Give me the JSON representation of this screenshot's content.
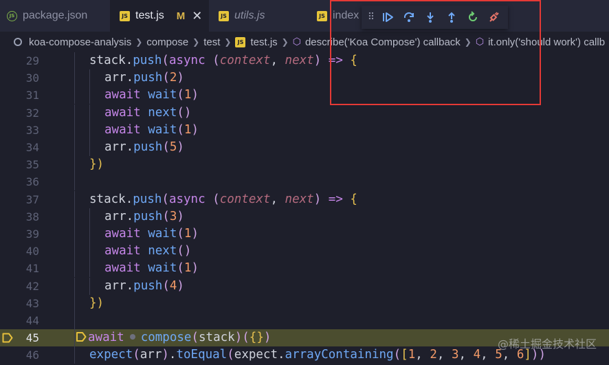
{
  "tabs": [
    {
      "label": "package.json",
      "icon": "json-file-icon"
    },
    {
      "label": "test.js",
      "icon": "js-file-icon",
      "modified": "M"
    },
    {
      "label": "utils.js",
      "icon": "js-file-icon"
    },
    {
      "label": "index",
      "icon": "js-file-icon"
    }
  ],
  "breadcrumb": [
    "koa-compose-analysis",
    "compose",
    "test",
    "test.js",
    "describe('Koa Compose') callback",
    "it.only('should work') callb"
  ],
  "debug_toolbar": {
    "buttons": [
      "continue",
      "step-over",
      "step-into",
      "step-out",
      "restart",
      "disconnect"
    ]
  },
  "code_lines": [
    {
      "num": "29",
      "indent": 1,
      "tokens": [
        [
          "stack",
          "plain"
        ],
        [
          ".",
          "punc"
        ],
        [
          "push",
          "fn"
        ],
        [
          "(",
          "paren"
        ],
        [
          "async ",
          "kw"
        ],
        [
          "(",
          "paren"
        ],
        [
          "context",
          "param"
        ],
        [
          ", ",
          "punc"
        ],
        [
          "next",
          "param"
        ],
        [
          ")",
          "paren"
        ],
        [
          " => ",
          "arrow"
        ],
        [
          "{",
          "brace"
        ]
      ]
    },
    {
      "num": "30",
      "indent": 2,
      "tokens": [
        [
          "arr",
          "plain"
        ],
        [
          ".",
          "punc"
        ],
        [
          "push",
          "fn"
        ],
        [
          "(",
          "paren"
        ],
        [
          "2",
          "num"
        ],
        [
          ")",
          "paren"
        ]
      ]
    },
    {
      "num": "31",
      "indent": 2,
      "tokens": [
        [
          "await ",
          "kw"
        ],
        [
          "wait",
          "fn"
        ],
        [
          "(",
          "paren"
        ],
        [
          "1",
          "num"
        ],
        [
          ")",
          "paren"
        ]
      ]
    },
    {
      "num": "32",
      "indent": 2,
      "tokens": [
        [
          "await ",
          "kw"
        ],
        [
          "next",
          "fn"
        ],
        [
          "()",
          "paren"
        ]
      ]
    },
    {
      "num": "33",
      "indent": 2,
      "tokens": [
        [
          "await ",
          "kw"
        ],
        [
          "wait",
          "fn"
        ],
        [
          "(",
          "paren"
        ],
        [
          "1",
          "num"
        ],
        [
          ")",
          "paren"
        ]
      ]
    },
    {
      "num": "34",
      "indent": 2,
      "tokens": [
        [
          "arr",
          "plain"
        ],
        [
          ".",
          "punc"
        ],
        [
          "push",
          "fn"
        ],
        [
          "(",
          "paren"
        ],
        [
          "5",
          "num"
        ],
        [
          ")",
          "paren"
        ]
      ]
    },
    {
      "num": "35",
      "indent": 1,
      "tokens": [
        [
          "})",
          "brace"
        ]
      ]
    },
    {
      "num": "36",
      "indent": 0,
      "tokens": []
    },
    {
      "num": "37",
      "indent": 1,
      "tokens": [
        [
          "stack",
          "plain"
        ],
        [
          ".",
          "punc"
        ],
        [
          "push",
          "fn"
        ],
        [
          "(",
          "paren"
        ],
        [
          "async ",
          "kw"
        ],
        [
          "(",
          "paren"
        ],
        [
          "context",
          "param"
        ],
        [
          ", ",
          "punc"
        ],
        [
          "next",
          "param"
        ],
        [
          ")",
          "paren"
        ],
        [
          " => ",
          "arrow"
        ],
        [
          "{",
          "brace"
        ]
      ]
    },
    {
      "num": "38",
      "indent": 2,
      "tokens": [
        [
          "arr",
          "plain"
        ],
        [
          ".",
          "punc"
        ],
        [
          "push",
          "fn"
        ],
        [
          "(",
          "paren"
        ],
        [
          "3",
          "num"
        ],
        [
          ")",
          "paren"
        ]
      ]
    },
    {
      "num": "39",
      "indent": 2,
      "tokens": [
        [
          "await ",
          "kw"
        ],
        [
          "wait",
          "fn"
        ],
        [
          "(",
          "paren"
        ],
        [
          "1",
          "num"
        ],
        [
          ")",
          "paren"
        ]
      ]
    },
    {
      "num": "40",
      "indent": 2,
      "tokens": [
        [
          "await ",
          "kw"
        ],
        [
          "next",
          "fn"
        ],
        [
          "()",
          "paren"
        ]
      ]
    },
    {
      "num": "41",
      "indent": 2,
      "tokens": [
        [
          "await ",
          "kw"
        ],
        [
          "wait",
          "fn"
        ],
        [
          "(",
          "paren"
        ],
        [
          "1",
          "num"
        ],
        [
          ")",
          "paren"
        ]
      ]
    },
    {
      "num": "42",
      "indent": 2,
      "tokens": [
        [
          "arr",
          "plain"
        ],
        [
          ".",
          "punc"
        ],
        [
          "push",
          "fn"
        ],
        [
          "(",
          "paren"
        ],
        [
          "4",
          "num"
        ],
        [
          ")",
          "paren"
        ]
      ]
    },
    {
      "num": "43",
      "indent": 1,
      "tokens": [
        [
          "})",
          "brace"
        ]
      ]
    },
    {
      "num": "44",
      "indent": 0,
      "tokens": []
    },
    {
      "num": "45",
      "indent": 1,
      "current": true,
      "tokens": [
        [
          "await",
          "kw"
        ],
        [
          "compose",
          "fn"
        ],
        [
          "(",
          "paren"
        ],
        [
          "stack",
          "plain"
        ],
        [
          ")",
          "paren"
        ],
        [
          "(",
          "paren"
        ],
        [
          "{}",
          "brace"
        ],
        [
          ")",
          "paren"
        ]
      ]
    },
    {
      "num": "46",
      "indent": 1,
      "tokens": [
        [
          "expect",
          "fn"
        ],
        [
          "(",
          "paren"
        ],
        [
          "arr",
          "plain"
        ],
        [
          ")",
          "paren"
        ],
        [
          ".",
          "punc"
        ],
        [
          "toEqual",
          "fn"
        ],
        [
          "(",
          "paren"
        ],
        [
          "expect",
          "plain"
        ],
        [
          ".",
          "punc"
        ],
        [
          "arrayContaining",
          "fn"
        ],
        [
          "(",
          "paren"
        ],
        [
          "[",
          "brace"
        ],
        [
          "1",
          "num"
        ],
        [
          ", ",
          "punc"
        ],
        [
          "2",
          "num"
        ],
        [
          ", ",
          "punc"
        ],
        [
          "3",
          "num"
        ],
        [
          ", ",
          "punc"
        ],
        [
          "4",
          "num"
        ],
        [
          ", ",
          "punc"
        ],
        [
          "5",
          "num"
        ],
        [
          ", ",
          "punc"
        ],
        [
          "6",
          "num"
        ],
        [
          "]",
          "brace"
        ],
        [
          "))",
          "paren"
        ]
      ]
    }
  ],
  "watermark": "@稀土掘金技术社区",
  "colors": {
    "background": "#1e1f2b",
    "current_line": "#4b4d2f",
    "highlight_border": "#e53935",
    "modified": "#d9b44a"
  }
}
